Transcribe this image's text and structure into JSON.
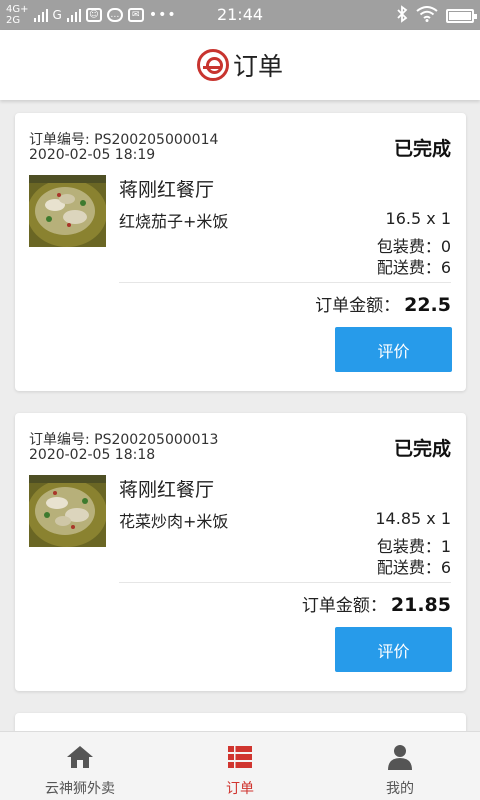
{
  "status_bar": {
    "network_top": "4G+",
    "network_bottom": "2G",
    "carrier": "G",
    "time": "21:44"
  },
  "header": {
    "title": "订单",
    "logo_icon": "brand-logo-icon"
  },
  "orders": [
    {
      "order_no": "订单编号: PS200205000014",
      "date": "2020-02-05 18:19",
      "status": "已完成",
      "restaurant": "蒋刚红餐厅",
      "dish": "红烧茄子+米饭",
      "price": "16.5 x 1",
      "packing_fee": "包装费：0",
      "delivery_fee": "配送费：6",
      "total_label": "订单金额：",
      "total_value": "22.5",
      "review_label": "评价"
    },
    {
      "order_no": "订单编号: PS200205000013",
      "date": "2020-02-05 18:18",
      "status": "已完成",
      "restaurant": "蒋刚红餐厅",
      "dish": "花菜炒肉+米饭",
      "price": "14.85 x 1",
      "packing_fee": "包装费：1",
      "delivery_fee": "配送费：6",
      "total_label": "订单金额：",
      "total_value": "21.85",
      "review_label": "评价"
    }
  ],
  "bottom_nav": [
    {
      "label": "云神狮外卖",
      "icon": "home-icon",
      "active": false
    },
    {
      "label": "订单",
      "icon": "list-icon",
      "active": true
    },
    {
      "label": "我的",
      "icon": "user-icon",
      "active": false
    }
  ],
  "colors": {
    "accent": "#d0352f",
    "button": "#279bea"
  }
}
